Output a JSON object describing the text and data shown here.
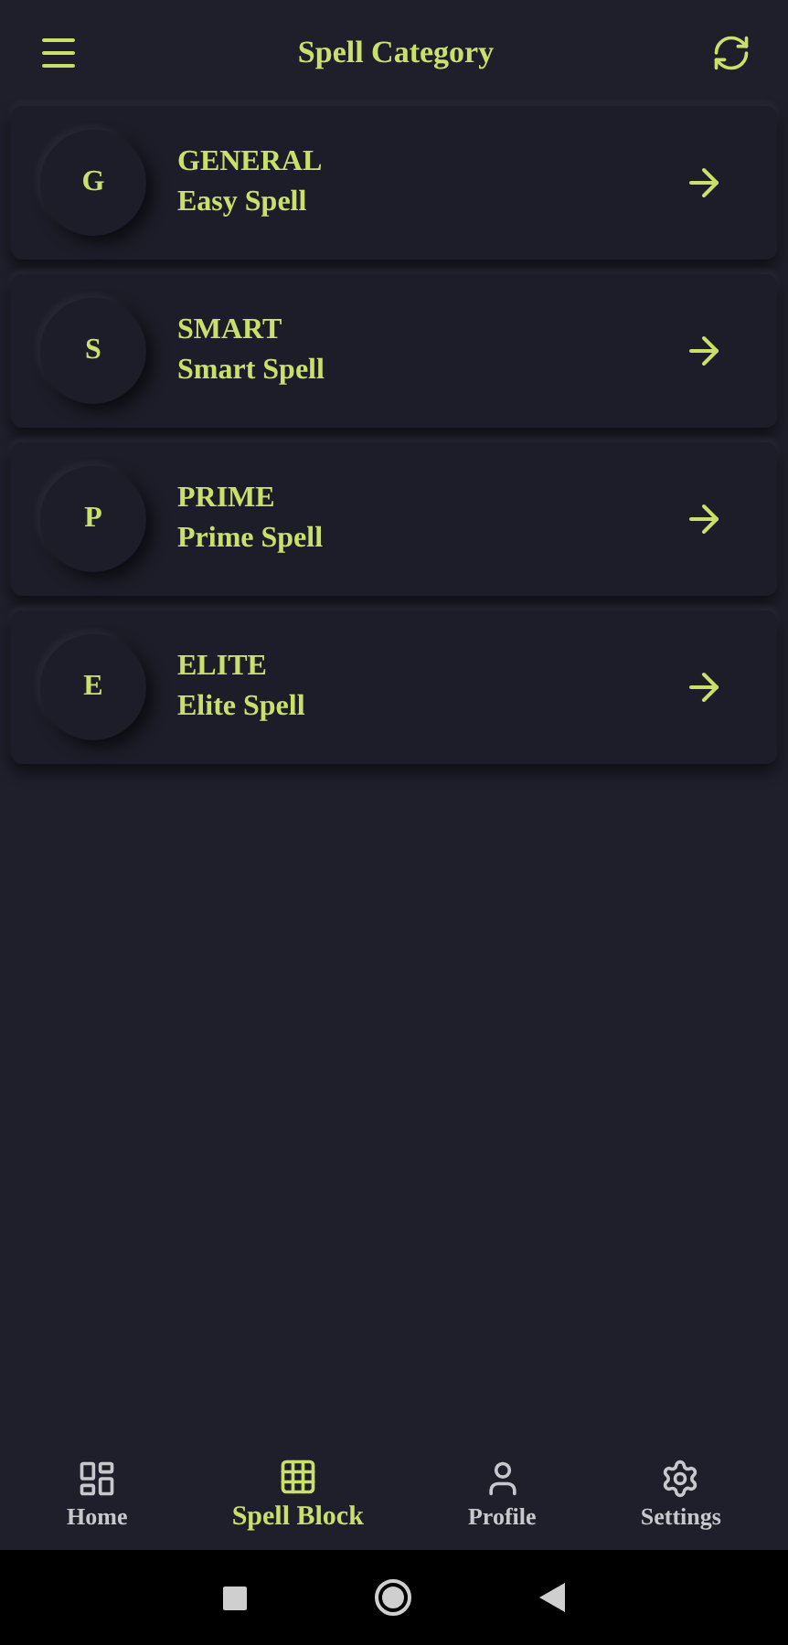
{
  "app_bar": {
    "title": "Spell Category"
  },
  "categories": [
    {
      "initial": "G",
      "name": "GENERAL",
      "subtitle": "Easy Spell"
    },
    {
      "initial": "S",
      "name": "SMART",
      "subtitle": "Smart Spell"
    },
    {
      "initial": "P",
      "name": "PRIME",
      "subtitle": "Prime Spell"
    },
    {
      "initial": "E",
      "name": "ELITE",
      "subtitle": "Elite Spell"
    }
  ],
  "bottom_nav": [
    {
      "kind": "home",
      "label": "Home",
      "selected": false
    },
    {
      "kind": "grid",
      "label": "Spell Block",
      "selected": true
    },
    {
      "kind": "profile",
      "label": "Profile",
      "selected": false
    },
    {
      "kind": "settings",
      "label": "Settings",
      "selected": false
    }
  ]
}
